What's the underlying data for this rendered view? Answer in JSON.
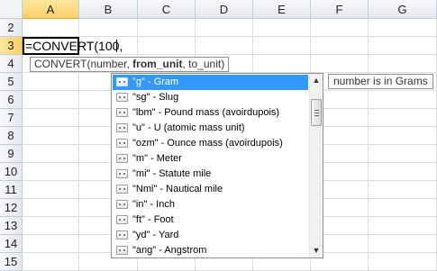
{
  "columns": [
    "A",
    "B",
    "C",
    "D",
    "E",
    "F",
    "G"
  ],
  "active_column": "A",
  "rows": [
    "2",
    "3",
    "4",
    "5",
    "6",
    "7",
    "8",
    "9",
    "10",
    "11",
    "12",
    "13",
    "14",
    "15"
  ],
  "active_row": "3",
  "formula": "=CONVERT(100,",
  "arg_tooltip": {
    "fn": "CONVERT(number, ",
    "current_arg": "from_unit",
    "rest": ", to_unit)"
  },
  "side_tooltip": "number is in Grams",
  "dropdown": {
    "selected_index": 0,
    "items": [
      {
        "label": "\"g\" - Gram"
      },
      {
        "label": "\"sg\" - Slug"
      },
      {
        "label": "\"lbm\" - Pound mass (avoirdupois)"
      },
      {
        "label": "\"u\" - U (atomic mass unit)"
      },
      {
        "label": "\"ozm\" - Ounce mass (avoirdupois)"
      },
      {
        "label": "\"m\" - Meter"
      },
      {
        "label": "\"mi\" - Statute mile"
      },
      {
        "label": "\"Nmi\" - Nautical mile"
      },
      {
        "label": "\"in\" - Inch"
      },
      {
        "label": "\"ft\" - Foot"
      },
      {
        "label": "\"yd\" - Yard"
      },
      {
        "label": "\"ang\" - Angstrom"
      }
    ]
  },
  "scrollbar": {
    "up_icon": "arrow-up-icon",
    "down_icon": "arrow-down-icon"
  }
}
